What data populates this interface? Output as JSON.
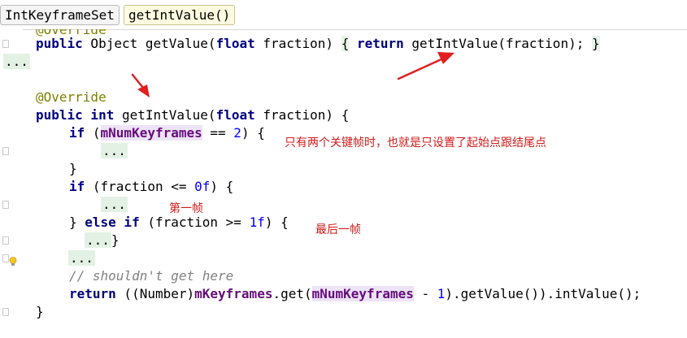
{
  "breadcrumb": {
    "items": [
      "IntKeyframeSet",
      "getIntValue()"
    ]
  },
  "code": {
    "line0_ann": "@Override",
    "line1": {
      "kw": "public",
      "type": " Object getValue(",
      "kw2": "float",
      "rest": " fraction) ",
      "b1": "{",
      "kw3": " return",
      "call": " getIntValue(fraction); ",
      "b2": "}"
    },
    "line2_fold": "...",
    "line3_ann": "@Override",
    "line4": {
      "kw": "public int",
      "rest": " getIntValue(",
      "kw2": "float",
      "rest2": " fraction) {"
    },
    "line5": {
      "kw": "if",
      "open": " (",
      "field": "mNumKeyframes",
      "op": " == ",
      "num": "2",
      "close": ") {"
    },
    "line6_fold": "...",
    "line7": "}",
    "line8": {
      "kw": "if",
      "rest": " (fraction <= ",
      "num": "0f",
      "close": ") {"
    },
    "line9_fold": "...",
    "line10": {
      "open": "} ",
      "kw": "else if",
      "rest": " (fraction >= ",
      "num": "1f",
      "close": ") {"
    },
    "line11_fold": "...",
    "line11_close": "}",
    "line12_fold": "...",
    "line13_comment": "// shouldn't get here",
    "line14": {
      "kw": "return",
      "p1": " ((Number)",
      "field": "mKeyframes",
      "p2": ".get(",
      "field2": "mNumKeyframes",
      "p3": " - ",
      "num": "1",
      "p4": ").getValue()).intValue();"
    },
    "line15": "}"
  },
  "annotations": {
    "note1": "只有两个关键帧时，也就是只设置了起始点跟结尾点",
    "note2": "第一帧",
    "note3": "最后一帧"
  },
  "colors": {
    "arrow": "#e02020",
    "note": "#d11a1a",
    "keyword": "#000080",
    "field": "#660e7a"
  }
}
